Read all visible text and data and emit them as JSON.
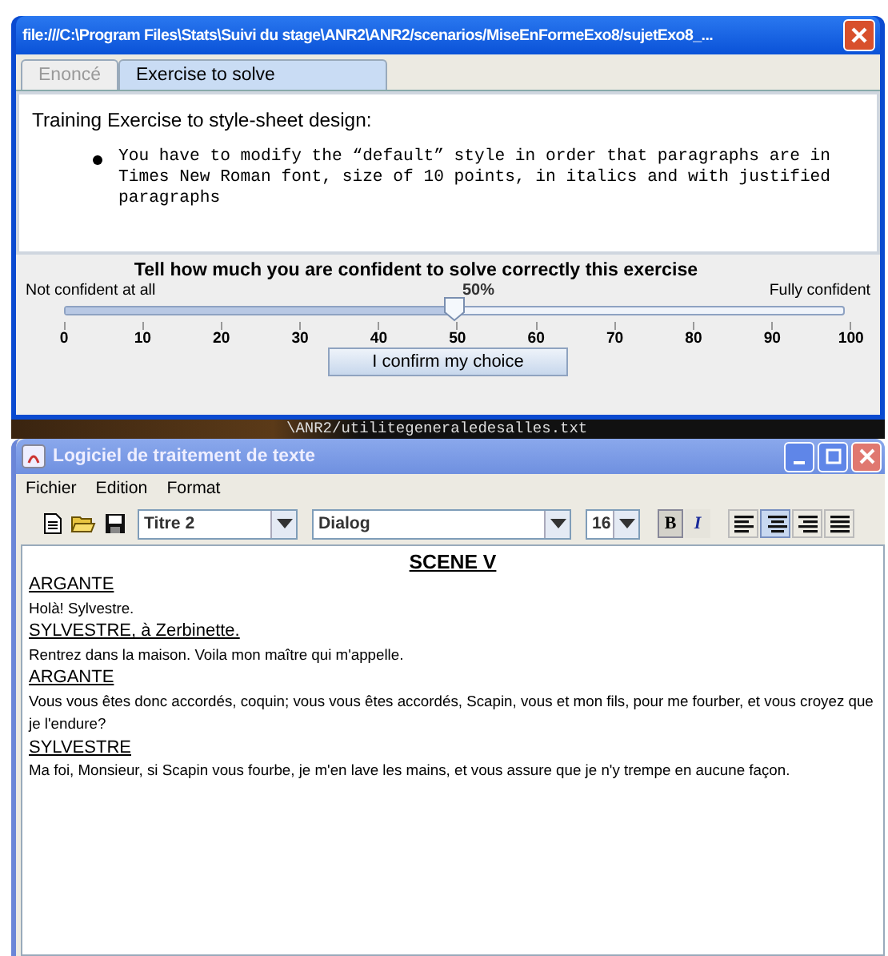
{
  "exercise_window": {
    "title": "file:///C:\\Program Files\\Stats\\Suivi du stage\\ANR2\\ANR2/scenarios/MiseEnFormeExo8/sujetExo8_...",
    "tabs": [
      {
        "label": "Enoncé",
        "selected": false
      },
      {
        "label": "Exercise to solve",
        "selected": true
      }
    ],
    "heading": "Training Exercise to style-sheet design:",
    "bullets": [
      "You have to modify the “default” style in order that paragraphs are in Times New Roman font, size of 10 points, in italics and with justified paragraphs"
    ],
    "confidence": {
      "question": "Tell how much you are confident to solve correctly this exercise",
      "min_label": "Not confident at all",
      "max_label": "Fully confident",
      "reading": "50%",
      "level": 0.5,
      "ticks": [
        "0",
        "10",
        "20",
        "30",
        "40",
        "50",
        "60",
        "70",
        "80",
        "90",
        "100"
      ],
      "confirm_button": "I confirm my choice"
    }
  },
  "background_text": "\\ANR2/utilitegeneraledesalles.txt",
  "editor_window": {
    "title": "Logiciel de traitement de texte",
    "menu": [
      "Fichier",
      "Edition",
      "Format"
    ],
    "style_combo": "Titre 2",
    "font_combo": "Dialog",
    "size_combo": "16",
    "format_toggles": [
      {
        "kind": "bold",
        "label": "B",
        "on": true
      },
      {
        "kind": "italic",
        "label": "I",
        "on": false
      }
    ],
    "alignments": [
      {
        "kind": "left",
        "selected": false
      },
      {
        "kind": "center",
        "selected": true
      },
      {
        "kind": "right",
        "selected": false
      },
      {
        "kind": "justify",
        "selected": false
      }
    ],
    "document": [
      {
        "kind": "title",
        "text": "SCENE V"
      },
      {
        "kind": "speaker",
        "text": "ARGANTE"
      },
      {
        "kind": "line",
        "text": "Holà! Sylvestre."
      },
      {
        "kind": "speaker",
        "text": "SYLVESTRE, à Zerbinette."
      },
      {
        "kind": "line",
        "text": "Rentrez dans la maison. Voila mon  maître qui m'appelle."
      },
      {
        "kind": "speaker",
        "text": "ARGANTE"
      },
      {
        "kind": "line",
        "text": "Vous vous êtes donc accordés, coquin; vous vous êtes accordés,  Scapin,  vous et mon fils, pour me fourber, et vous croyez que je  l'endure?"
      },
      {
        "kind": "speaker",
        "text": "SYLVESTRE"
      },
      {
        "kind": "line",
        "text": "Ma foi, Monsieur, si Scapin vous fourbe, je m'en lave les mains, et  vous assure que je n'y trempe en aucune façon."
      }
    ]
  }
}
